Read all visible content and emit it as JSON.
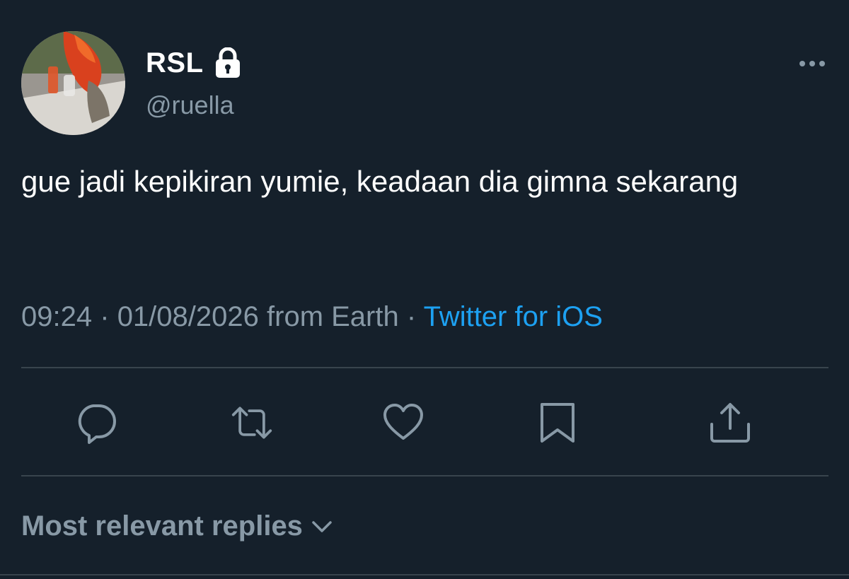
{
  "author": {
    "display_name": "RSL",
    "handle": "@ruella",
    "protected": true
  },
  "tweet": {
    "text": "gue jadi kepikiran yumie, keadaan dia gimna sekarang",
    "time": "09:24",
    "separator": "·",
    "date": "01/08/2026",
    "location": "from Earth",
    "source": "Twitter for iOS"
  },
  "actions": [
    {
      "name": "reply",
      "icon": "reply-icon"
    },
    {
      "name": "retweet",
      "icon": "retweet-icon"
    },
    {
      "name": "like",
      "icon": "heart-icon"
    },
    {
      "name": "bookmark",
      "icon": "bookmark-icon"
    },
    {
      "name": "share",
      "icon": "share-icon"
    }
  ],
  "replies_sort": {
    "label": "Most relevant replies"
  },
  "colors": {
    "background": "#15202b",
    "text_primary": "#ffffff",
    "text_secondary": "#8899a6",
    "link": "#1da1f2",
    "divider": "#38444d"
  }
}
